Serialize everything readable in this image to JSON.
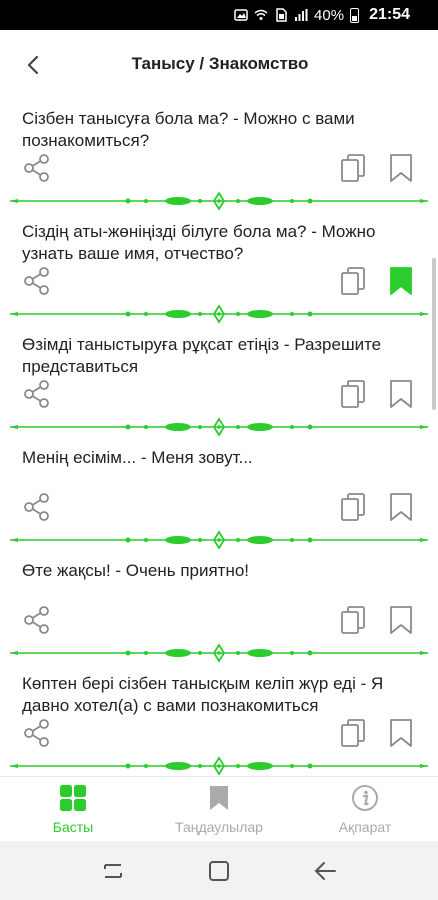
{
  "status_bar": {
    "battery": "40%",
    "time": "21:54"
  },
  "header": {
    "title": "Танысу / Знакомство"
  },
  "phrases": [
    {
      "text": "Сізбен танысуға бола ма? - Можно с вами познакомиться?",
      "bookmarked": false
    },
    {
      "text": "Сіздің аты-жөніңізді білуге бола ма? - Можно узнать ваше имя, отчество?",
      "bookmarked": true
    },
    {
      "text": "Өзімді таныстыруға рұқсат етіңіз - Разрешите представиться",
      "bookmarked": false
    },
    {
      "text": "Менің есімім... - Меня зовут...",
      "bookmarked": false
    },
    {
      "text": "Өте жақсы! - Очень приятно!",
      "bookmarked": false
    },
    {
      "text": " Көптен бері сізбен танысқым келіп жүр еді - Я давно хотел(а) с вами познакомиться",
      "bookmarked": false
    }
  ],
  "bottom_nav": {
    "items": [
      {
        "label": "Басты",
        "icon": "grid-icon",
        "active": true
      },
      {
        "label": "Таңдаулылар",
        "icon": "bookmark-icon",
        "active": false
      },
      {
        "label": "Ақпарат",
        "icon": "info-icon",
        "active": false
      }
    ]
  },
  "colors": {
    "accent": "#2bcc2b",
    "icon_gray": "#8a8a8a",
    "inactive_nav": "#aaaaaa"
  }
}
